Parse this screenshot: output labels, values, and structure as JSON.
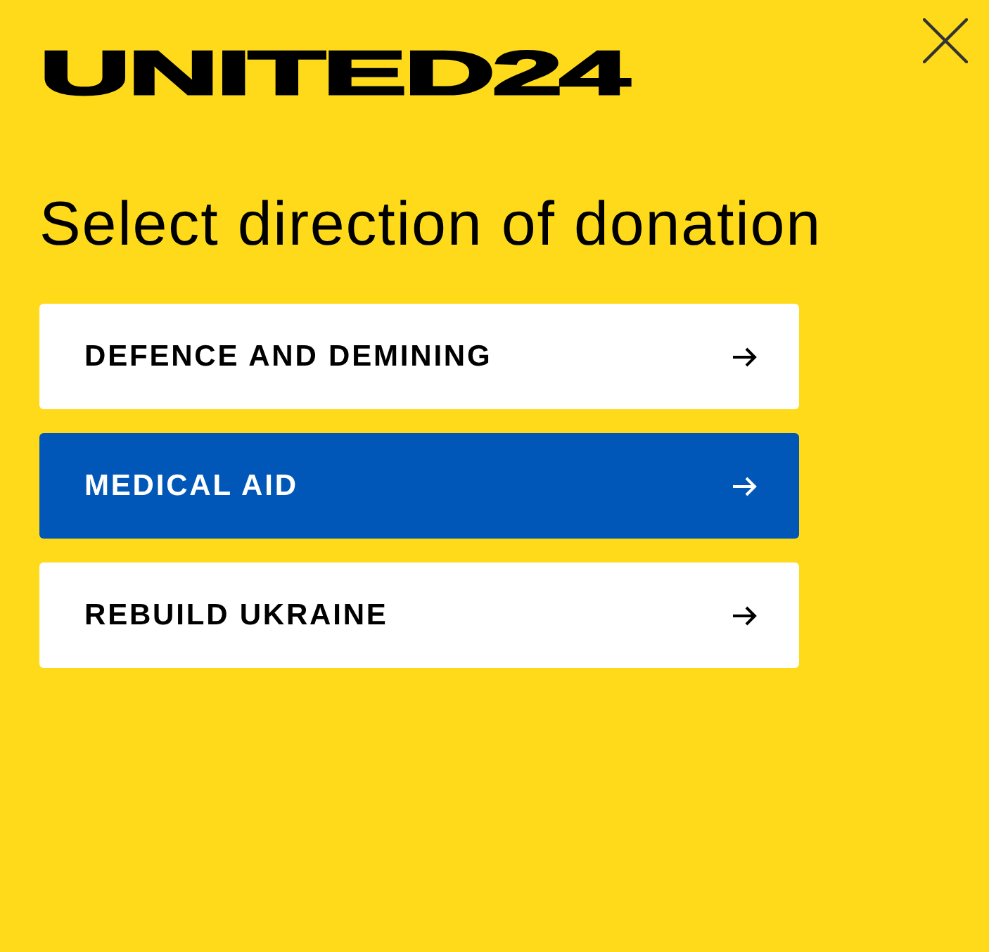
{
  "logo": "UNITED24",
  "heading": "Select direction of donation",
  "directions": [
    {
      "label": "DEFENCE AND DEMINING",
      "selected": false
    },
    {
      "label": "MEDICAL AID",
      "selected": true
    },
    {
      "label": "REBUILD UKRAINE",
      "selected": false
    }
  ]
}
